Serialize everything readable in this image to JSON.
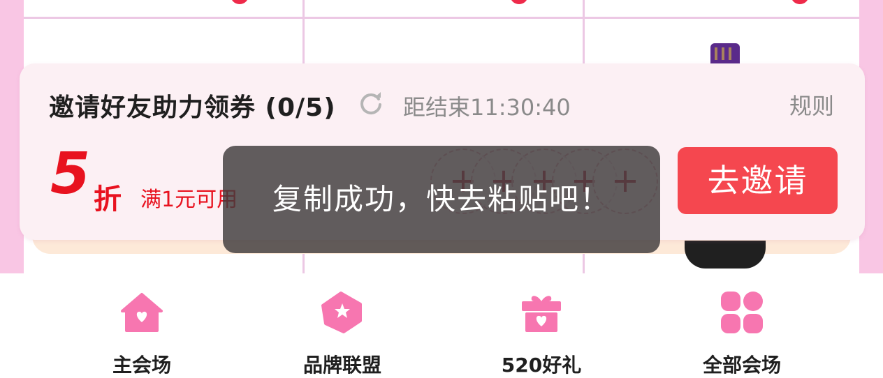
{
  "invite": {
    "title": "邀请好友助力领券 (0/5)",
    "countdown": "距结束11:30:40",
    "rules_label": "规则",
    "discount_value": "5",
    "discount_unit": "折",
    "min_spend": "满1元可用",
    "slot_label": "+",
    "button_label": "去邀请"
  },
  "toast": {
    "message": "复制成功，快去粘贴吧！"
  },
  "bottom_nav": {
    "items": [
      {
        "label": "主会场",
        "icon": "home-icon"
      },
      {
        "label": "品牌联盟",
        "icon": "brand-tag-icon"
      },
      {
        "label": "520好礼",
        "icon": "gift-icon"
      },
      {
        "label": "全部会场",
        "icon": "grid-icon"
      }
    ]
  },
  "colors": {
    "accent": "#f5474f",
    "discount_red": "#e8121f",
    "nav_icon_pink": "#f776b0",
    "page_pink": "#f9c6e4"
  }
}
